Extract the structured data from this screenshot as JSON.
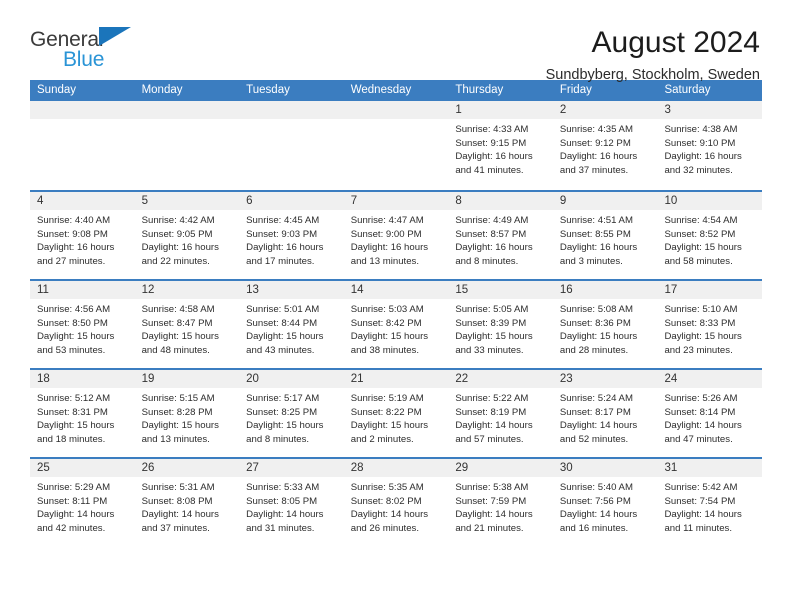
{
  "brand": {
    "name_line1": "General",
    "name_line2": "Blue",
    "flag_icon": "triangle-flag-icon"
  },
  "header": {
    "title": "August 2024",
    "location": "Sundbyberg, Stockholm, Sweden"
  },
  "colors": {
    "header_blue": "#3b7dc0",
    "brand_blue": "#2a94d6",
    "day_band_gray": "#f0f0f0"
  },
  "weekdays": [
    "Sunday",
    "Monday",
    "Tuesday",
    "Wednesday",
    "Thursday",
    "Friday",
    "Saturday"
  ],
  "weeks": [
    [
      {
        "day": "",
        "empty": true
      },
      {
        "day": "",
        "empty": true
      },
      {
        "day": "",
        "empty": true
      },
      {
        "day": "",
        "empty": true
      },
      {
        "day": "1",
        "sunrise": "Sunrise: 4:33 AM",
        "sunset": "Sunset: 9:15 PM",
        "daylight1": "Daylight: 16 hours",
        "daylight2": "and 41 minutes."
      },
      {
        "day": "2",
        "sunrise": "Sunrise: 4:35 AM",
        "sunset": "Sunset: 9:12 PM",
        "daylight1": "Daylight: 16 hours",
        "daylight2": "and 37 minutes."
      },
      {
        "day": "3",
        "sunrise": "Sunrise: 4:38 AM",
        "sunset": "Sunset: 9:10 PM",
        "daylight1": "Daylight: 16 hours",
        "daylight2": "and 32 minutes."
      }
    ],
    [
      {
        "day": "4",
        "sunrise": "Sunrise: 4:40 AM",
        "sunset": "Sunset: 9:08 PM",
        "daylight1": "Daylight: 16 hours",
        "daylight2": "and 27 minutes."
      },
      {
        "day": "5",
        "sunrise": "Sunrise: 4:42 AM",
        "sunset": "Sunset: 9:05 PM",
        "daylight1": "Daylight: 16 hours",
        "daylight2": "and 22 minutes."
      },
      {
        "day": "6",
        "sunrise": "Sunrise: 4:45 AM",
        "sunset": "Sunset: 9:03 PM",
        "daylight1": "Daylight: 16 hours",
        "daylight2": "and 17 minutes."
      },
      {
        "day": "7",
        "sunrise": "Sunrise: 4:47 AM",
        "sunset": "Sunset: 9:00 PM",
        "daylight1": "Daylight: 16 hours",
        "daylight2": "and 13 minutes."
      },
      {
        "day": "8",
        "sunrise": "Sunrise: 4:49 AM",
        "sunset": "Sunset: 8:57 PM",
        "daylight1": "Daylight: 16 hours",
        "daylight2": "and 8 minutes."
      },
      {
        "day": "9",
        "sunrise": "Sunrise: 4:51 AM",
        "sunset": "Sunset: 8:55 PM",
        "daylight1": "Daylight: 16 hours",
        "daylight2": "and 3 minutes."
      },
      {
        "day": "10",
        "sunrise": "Sunrise: 4:54 AM",
        "sunset": "Sunset: 8:52 PM",
        "daylight1": "Daylight: 15 hours",
        "daylight2": "and 58 minutes."
      }
    ],
    [
      {
        "day": "11",
        "sunrise": "Sunrise: 4:56 AM",
        "sunset": "Sunset: 8:50 PM",
        "daylight1": "Daylight: 15 hours",
        "daylight2": "and 53 minutes."
      },
      {
        "day": "12",
        "sunrise": "Sunrise: 4:58 AM",
        "sunset": "Sunset: 8:47 PM",
        "daylight1": "Daylight: 15 hours",
        "daylight2": "and 48 minutes."
      },
      {
        "day": "13",
        "sunrise": "Sunrise: 5:01 AM",
        "sunset": "Sunset: 8:44 PM",
        "daylight1": "Daylight: 15 hours",
        "daylight2": "and 43 minutes."
      },
      {
        "day": "14",
        "sunrise": "Sunrise: 5:03 AM",
        "sunset": "Sunset: 8:42 PM",
        "daylight1": "Daylight: 15 hours",
        "daylight2": "and 38 minutes."
      },
      {
        "day": "15",
        "sunrise": "Sunrise: 5:05 AM",
        "sunset": "Sunset: 8:39 PM",
        "daylight1": "Daylight: 15 hours",
        "daylight2": "and 33 minutes."
      },
      {
        "day": "16",
        "sunrise": "Sunrise: 5:08 AM",
        "sunset": "Sunset: 8:36 PM",
        "daylight1": "Daylight: 15 hours",
        "daylight2": "and 28 minutes."
      },
      {
        "day": "17",
        "sunrise": "Sunrise: 5:10 AM",
        "sunset": "Sunset: 8:33 PM",
        "daylight1": "Daylight: 15 hours",
        "daylight2": "and 23 minutes."
      }
    ],
    [
      {
        "day": "18",
        "sunrise": "Sunrise: 5:12 AM",
        "sunset": "Sunset: 8:31 PM",
        "daylight1": "Daylight: 15 hours",
        "daylight2": "and 18 minutes."
      },
      {
        "day": "19",
        "sunrise": "Sunrise: 5:15 AM",
        "sunset": "Sunset: 8:28 PM",
        "daylight1": "Daylight: 15 hours",
        "daylight2": "and 13 minutes."
      },
      {
        "day": "20",
        "sunrise": "Sunrise: 5:17 AM",
        "sunset": "Sunset: 8:25 PM",
        "daylight1": "Daylight: 15 hours",
        "daylight2": "and 8 minutes."
      },
      {
        "day": "21",
        "sunrise": "Sunrise: 5:19 AM",
        "sunset": "Sunset: 8:22 PM",
        "daylight1": "Daylight: 15 hours",
        "daylight2": "and 2 minutes."
      },
      {
        "day": "22",
        "sunrise": "Sunrise: 5:22 AM",
        "sunset": "Sunset: 8:19 PM",
        "daylight1": "Daylight: 14 hours",
        "daylight2": "and 57 minutes."
      },
      {
        "day": "23",
        "sunrise": "Sunrise: 5:24 AM",
        "sunset": "Sunset: 8:17 PM",
        "daylight1": "Daylight: 14 hours",
        "daylight2": "and 52 minutes."
      },
      {
        "day": "24",
        "sunrise": "Sunrise: 5:26 AM",
        "sunset": "Sunset: 8:14 PM",
        "daylight1": "Daylight: 14 hours",
        "daylight2": "and 47 minutes."
      }
    ],
    [
      {
        "day": "25",
        "sunrise": "Sunrise: 5:29 AM",
        "sunset": "Sunset: 8:11 PM",
        "daylight1": "Daylight: 14 hours",
        "daylight2": "and 42 minutes."
      },
      {
        "day": "26",
        "sunrise": "Sunrise: 5:31 AM",
        "sunset": "Sunset: 8:08 PM",
        "daylight1": "Daylight: 14 hours",
        "daylight2": "and 37 minutes."
      },
      {
        "day": "27",
        "sunrise": "Sunrise: 5:33 AM",
        "sunset": "Sunset: 8:05 PM",
        "daylight1": "Daylight: 14 hours",
        "daylight2": "and 31 minutes."
      },
      {
        "day": "28",
        "sunrise": "Sunrise: 5:35 AM",
        "sunset": "Sunset: 8:02 PM",
        "daylight1": "Daylight: 14 hours",
        "daylight2": "and 26 minutes."
      },
      {
        "day": "29",
        "sunrise": "Sunrise: 5:38 AM",
        "sunset": "Sunset: 7:59 PM",
        "daylight1": "Daylight: 14 hours",
        "daylight2": "and 21 minutes."
      },
      {
        "day": "30",
        "sunrise": "Sunrise: 5:40 AM",
        "sunset": "Sunset: 7:56 PM",
        "daylight1": "Daylight: 14 hours",
        "daylight2": "and 16 minutes."
      },
      {
        "day": "31",
        "sunrise": "Sunrise: 5:42 AM",
        "sunset": "Sunset: 7:54 PM",
        "daylight1": "Daylight: 14 hours",
        "daylight2": "and 11 minutes."
      }
    ]
  ]
}
